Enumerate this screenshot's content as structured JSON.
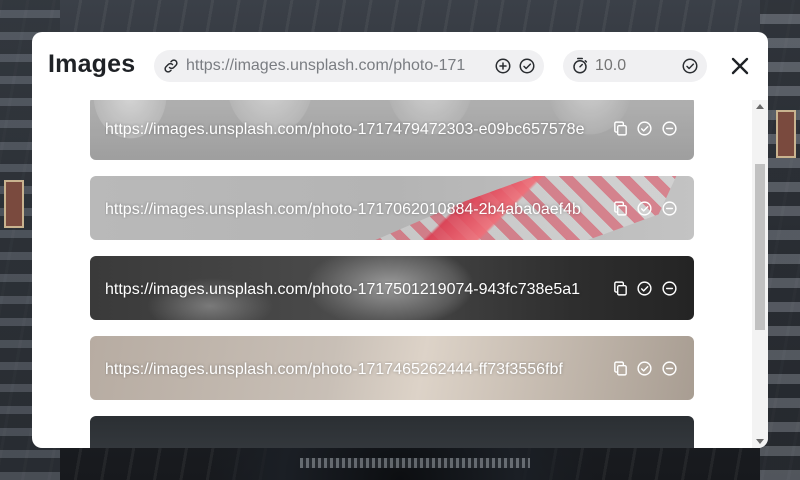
{
  "modal": {
    "title": "Images",
    "url_input": {
      "value": "https://images.unsplash.com/photo-171"
    },
    "interval_input": {
      "placeholder": "10.0"
    }
  },
  "images": [
    {
      "url": "https://images.unsplash.com/photo-1717479472303-e09bc657578e"
    },
    {
      "url": "https://images.unsplash.com/photo-1717062010884-2b4aba0aef4b"
    },
    {
      "url": "https://images.unsplash.com/photo-1717501219074-943fc738e5a1"
    },
    {
      "url": "https://images.unsplash.com/photo-1717465262444-ff73f3556fbf"
    },
    {
      "url": ""
    }
  ],
  "icons": {
    "url_prefix": "link-icon",
    "add": "plus-circle-icon",
    "confirm": "check-circle-icon",
    "interval": "stopwatch-icon",
    "close": "close-icon",
    "copy": "copy-icon",
    "select": "check-circle-icon",
    "remove": "minus-circle-icon"
  },
  "colors": {
    "modal_bg": "#ffffff",
    "pill_bg": "#f0f0f2",
    "title": "#1f2226",
    "icon": "#2a2d31",
    "overlay_text": "#ffffff"
  }
}
